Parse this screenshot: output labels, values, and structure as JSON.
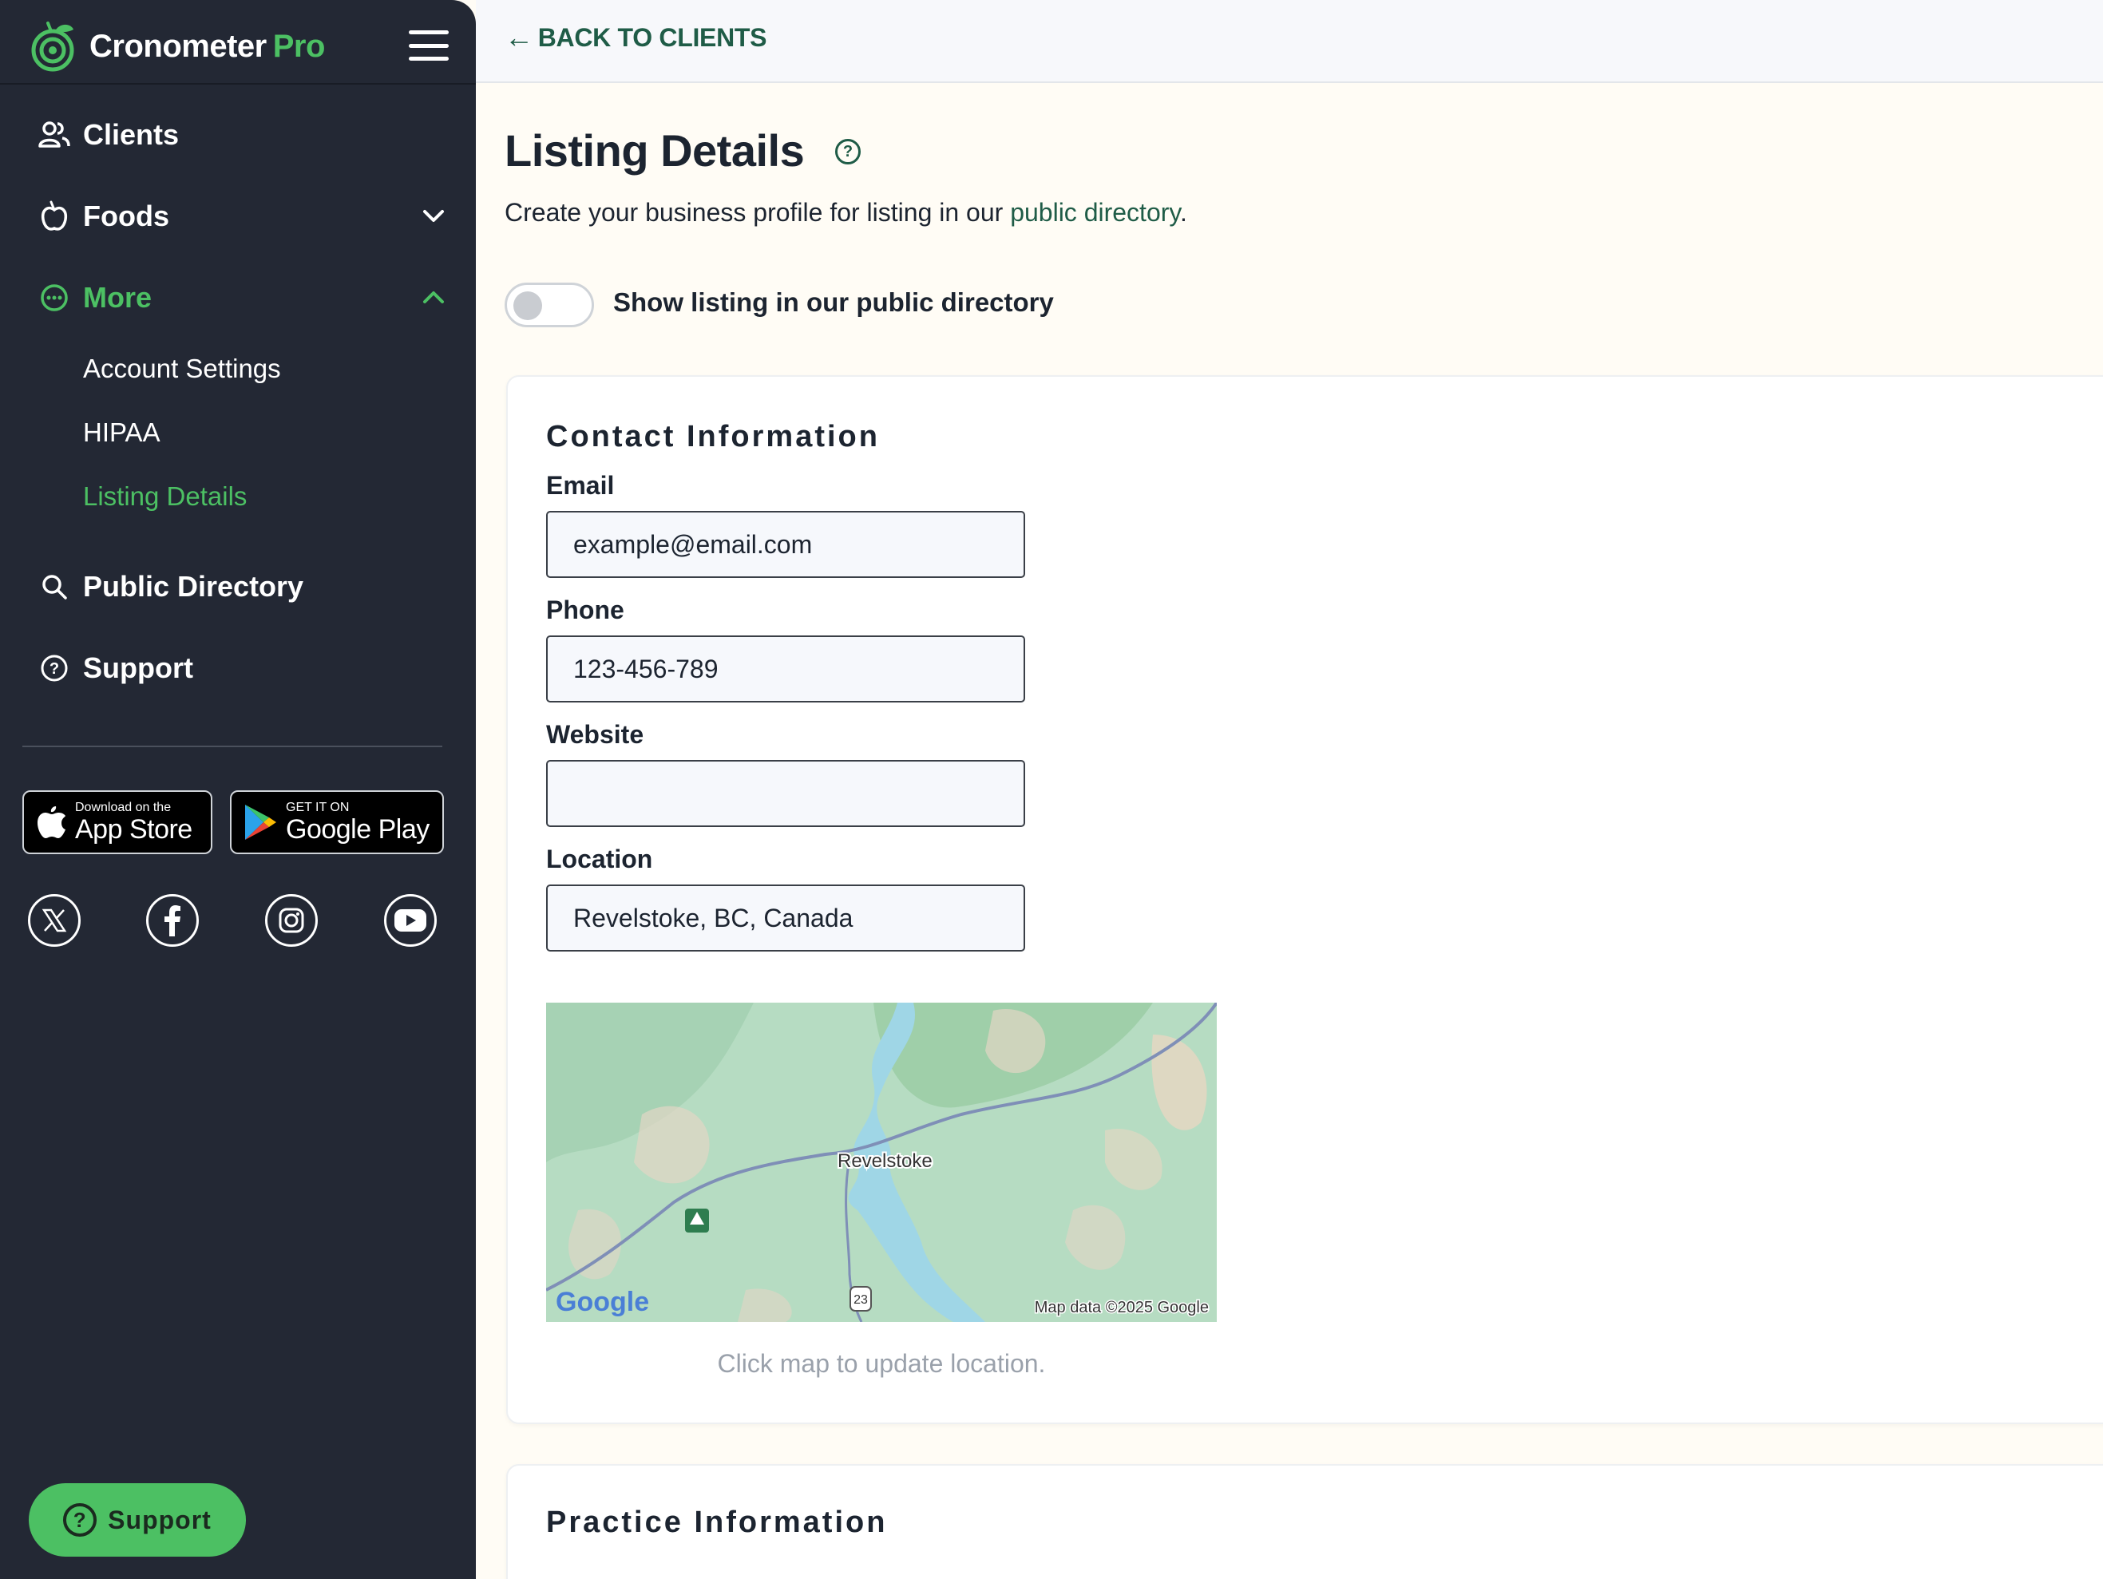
{
  "brand": {
    "name": "Cronometer",
    "suffix": "Pro"
  },
  "nav": {
    "clients": "Clients",
    "foods": "Foods",
    "more": "More",
    "more_sub": [
      "Account Settings",
      "HIPAA",
      "Listing Details"
    ],
    "public_directory": "Public Directory",
    "support": "Support"
  },
  "stores": {
    "apple_small": "Download on the",
    "apple_big": "App Store",
    "google_small": "GET IT ON",
    "google_big": "Google Play"
  },
  "support_button": "Support",
  "topbar": {
    "back": "BACK TO CLIENTS"
  },
  "page": {
    "title": "Listing Details",
    "subtitle_prefix": "Create your business profile for listing in our ",
    "subtitle_link": "public directory",
    "subtitle_suffix": ".",
    "toggle_label": "Show listing in our public directory"
  },
  "contact": {
    "title": "Contact Information",
    "email_label": "Email",
    "email_value": "example@email.com",
    "phone_label": "Phone",
    "phone_value": "123-456-789",
    "website_label": "Website",
    "website_value": "",
    "location_label": "Location",
    "location_value": "Revelstoke, BC, Canada",
    "map_city": "Revelstoke",
    "map_google": "Google",
    "map_attribution": "Map data ©2025 Google",
    "map_route": "23",
    "map_caption": "Click map to update location."
  },
  "practice": {
    "title": "Practice Information"
  },
  "colors": {
    "accent": "#4cc063",
    "link": "#1f5c47",
    "sidebar": "#232834"
  }
}
